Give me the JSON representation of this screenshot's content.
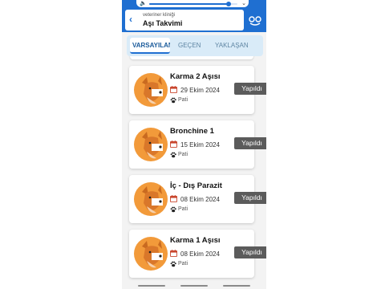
{
  "media_bar": {
    "volume_icon": "speaker-icon",
    "volume_level": 0.9,
    "chevron_icon": "chevron-down-icon"
  },
  "header": {
    "subtitle": "veteriner kliniği",
    "title": "Aşı Takvimi",
    "back_icon": "back-arrow-icon",
    "logo_icon": "clinic-logo-icon"
  },
  "tabs": [
    {
      "label": "VARSAYILAN",
      "active": true
    },
    {
      "label": "GEÇEN",
      "active": false
    },
    {
      "label": "YAKLAŞAN",
      "active": false
    }
  ],
  "cards": [
    {
      "title": "Karma 2 Aşısı",
      "date": "29 Ekim 2024",
      "pet": "Pati",
      "status": "Yapıldı"
    },
    {
      "title": "Bronchine 1",
      "date": "15 Ekim 2024",
      "pet": "Pati",
      "status": "Yapıldı"
    },
    {
      "title": "İç - Dış Parazit",
      "date": "08 Ekim 2024",
      "pet": "Pati",
      "status": "Yapıldı"
    },
    {
      "title": "Karma 1 Aşısı",
      "date": "08 Ekim 2024",
      "pet": "Pati",
      "status": "Yapıldı"
    }
  ],
  "colors": {
    "primary": "#1f6fd1",
    "tab_background": "#d9ebf8",
    "avatar": "#f29a3a",
    "badge": "#5b5b5b"
  }
}
